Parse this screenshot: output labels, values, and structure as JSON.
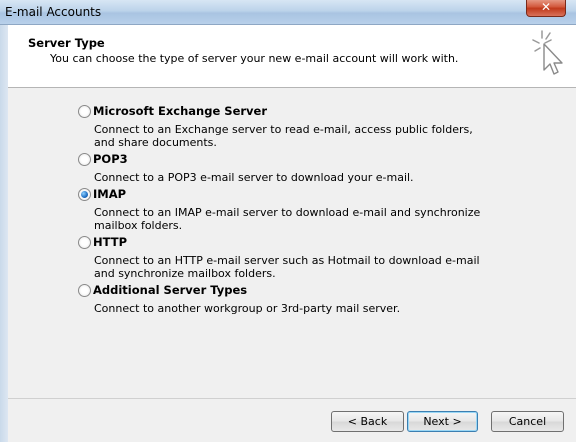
{
  "window": {
    "title": "E-mail Accounts",
    "close_glyph": "✕"
  },
  "header": {
    "title": "Server Type",
    "subtitle": "You can choose the type of server your new e-mail account will work with."
  },
  "options": [
    {
      "label": "Microsoft Exchange Server",
      "description": "Connect to an Exchange server to read e-mail, access public folders, and share documents.",
      "selected": false
    },
    {
      "label": "POP3",
      "description": "Connect to a POP3 e-mail server to download your e-mail.",
      "selected": false
    },
    {
      "label": "IMAP",
      "description": "Connect to an IMAP e-mail server to download e-mail and synchronize mailbox folders.",
      "selected": true
    },
    {
      "label": "HTTP",
      "description": "Connect to an HTTP e-mail server such as Hotmail to download e-mail and synchronize mailbox folders.",
      "selected": false
    },
    {
      "label": "Additional Server Types",
      "description": "Connect to another workgroup or 3rd-party mail server.",
      "selected": false
    }
  ],
  "buttons": {
    "back": "< Back",
    "next": "Next >",
    "cancel": "Cancel"
  }
}
